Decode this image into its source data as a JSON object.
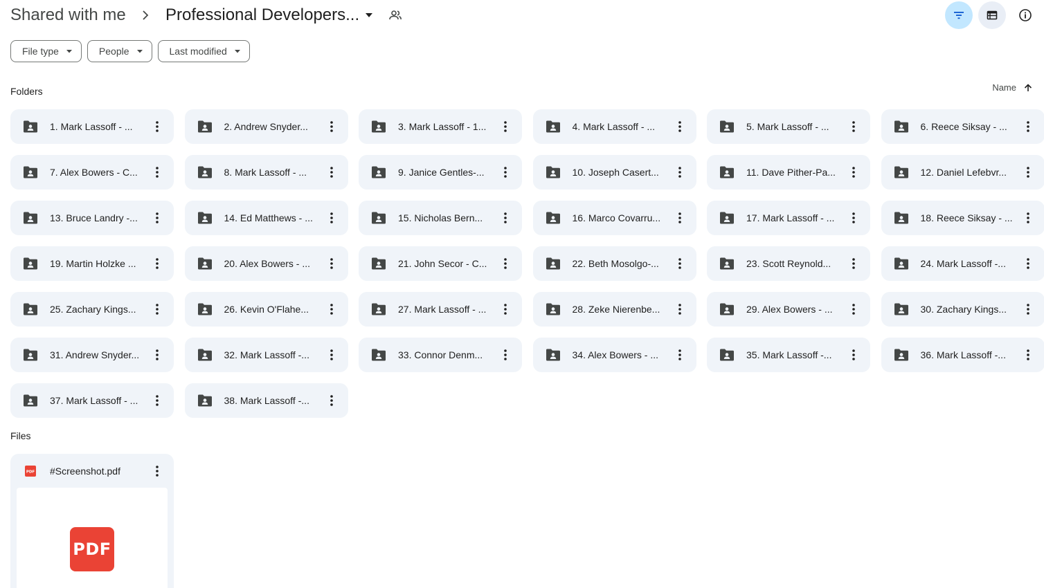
{
  "breadcrumb": {
    "root": "Shared with me",
    "current": "Professional Developers...",
    "separator_icon": "chevron-right-icon",
    "caret_icon": "caret-down-icon",
    "shared_icon": "people-outline-icon"
  },
  "header_actions": {
    "filter_icon": "filter-list-icon",
    "list_icon": "list-view-icon",
    "info_icon": "info-icon",
    "filter_active_color": "#c2e7ff",
    "list_bg_color": "#e9eef6"
  },
  "filters": [
    {
      "label": "File type"
    },
    {
      "label": "People"
    },
    {
      "label": "Last modified"
    }
  ],
  "folders_section": {
    "label": "Folders",
    "sort_label": "Name",
    "sort_icon": "arrow-up-icon",
    "items": [
      "1. Mark Lassoff - ...",
      "2. Andrew Snyder...",
      "3. Mark Lassoff - 1...",
      "4. Mark Lassoff - ...",
      "5. Mark Lassoff - ...",
      "6. Reece Siksay - ...",
      "7. Alex Bowers - C...",
      "8. Mark Lassoff - ...",
      "9. Janice Gentles-...",
      "10. Joseph Casert...",
      "11. Dave Pither-Pa...",
      "12. Daniel Lefebvr...",
      "13. Bruce Landry -...",
      "14. Ed Matthews - ...",
      "15. Nicholas Bern...",
      "16. Marco Covarru...",
      "17. Mark Lassoff - ...",
      "18. Reece Siksay - ...",
      "19. Martin Holzke ...",
      "20. Alex Bowers - ...",
      "21. John Secor - C...",
      "22. Beth Mosolgo-...",
      "23. Scott Reynold...",
      "24. Mark Lassoff -...",
      "25. Zachary Kings...",
      "26. Kevin O'Flahe...",
      "27. Mark Lassoff - ...",
      "28. Zeke Nierenbe...",
      "29. Alex Bowers - ...",
      "30. Zachary Kings...",
      "31. Andrew Snyder...",
      "32. Mark Lassoff -...",
      "33. Connor Denm...",
      "34. Alex Bowers - ...",
      "35. Mark Lassoff -...",
      "36. Mark Lassoff -...",
      "37. Mark Lassoff - ...",
      "38. Mark Lassoff -..."
    ]
  },
  "files_section": {
    "label": "Files",
    "items": [
      {
        "name": "#Screenshot.pdf",
        "badge_small": "PDF",
        "badge_big": "PDF",
        "color": "#ea4335"
      }
    ]
  }
}
